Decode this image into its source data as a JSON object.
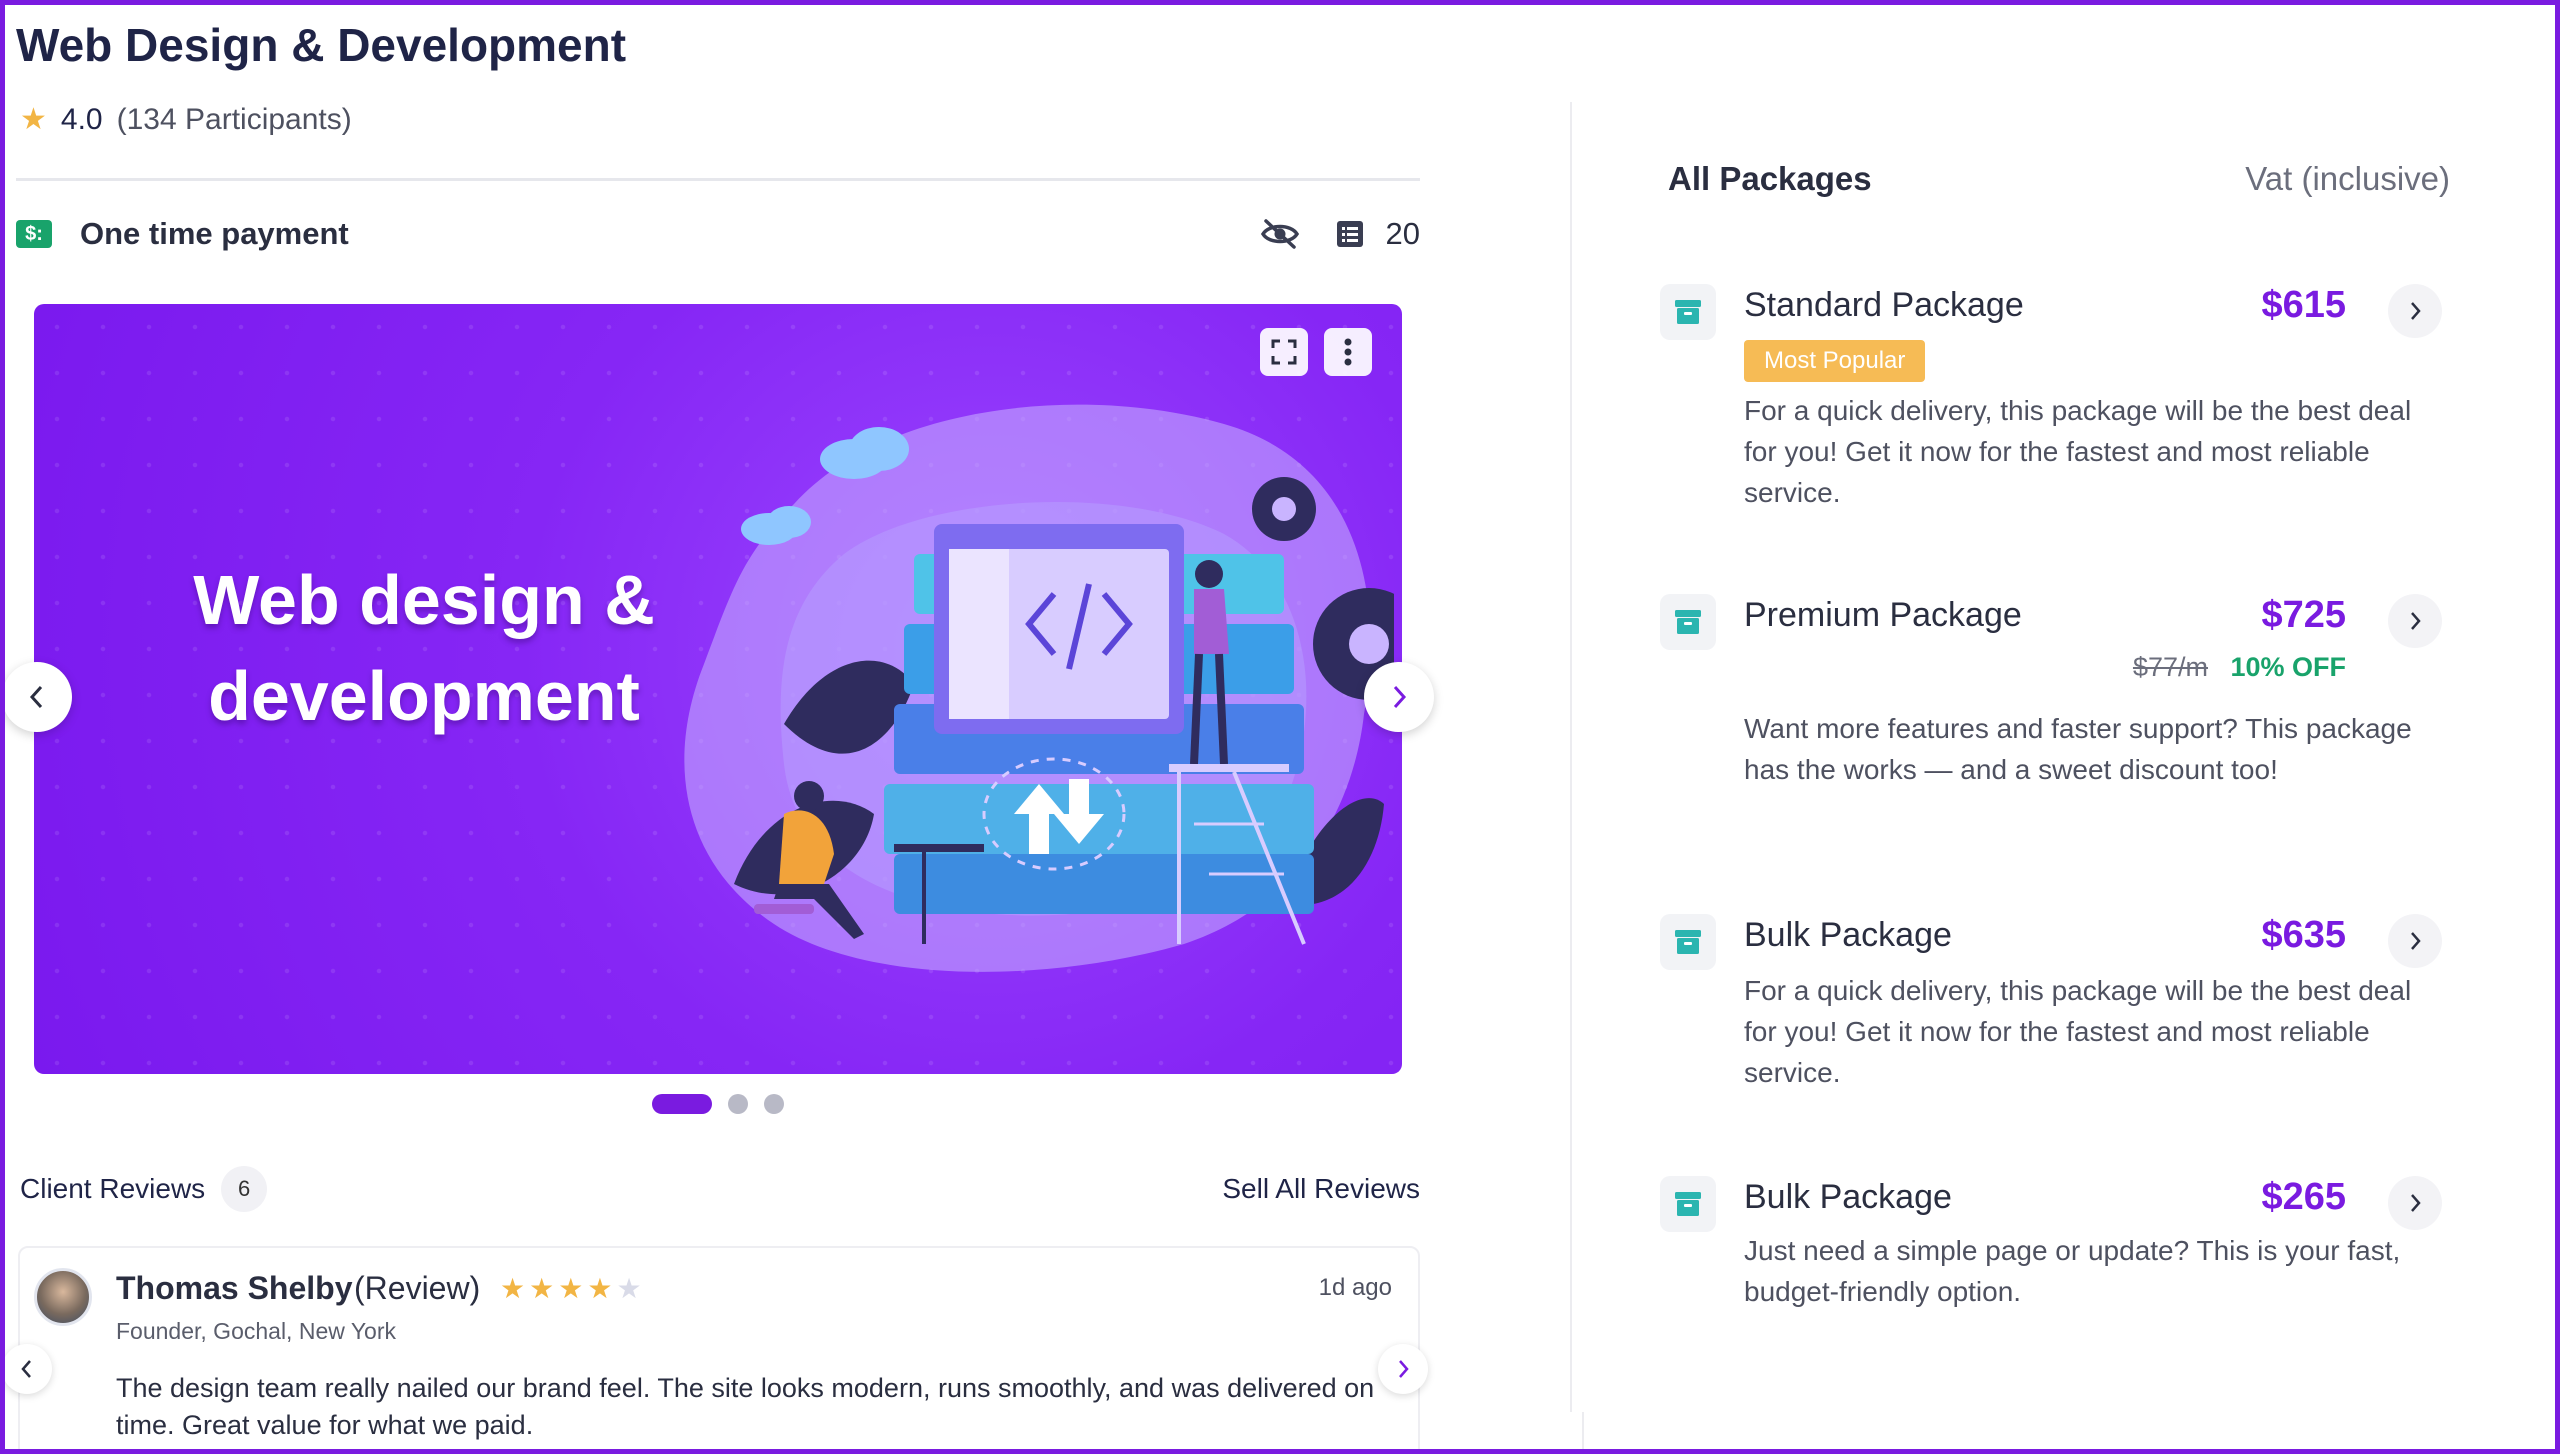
{
  "course": {
    "title": "Web Design & Development",
    "rating": "4.0",
    "participants": "(134 Participants)"
  },
  "payment": {
    "label": "One time payment",
    "pay_icon_text": "$:",
    "lessons_count": "20"
  },
  "hero": {
    "text_line1": "Web design &",
    "text_line2": "development"
  },
  "reviews": {
    "title": "Client Reviews",
    "count": "6",
    "see_all_label": "Sell All Reviews",
    "items": [
      {
        "name": "Thomas Shelby",
        "tag": "(Review)",
        "stars_filled": 4,
        "stars_total": 5,
        "time": "1d ago",
        "role": "Founder, Gochal, New York",
        "text": "The design team really nailed our brand feel. The site looks modern, runs smoothly, and was delivered on time. Great value for what we paid."
      }
    ]
  },
  "packages": {
    "title": "All Packages",
    "vat_label": "Vat (inclusive)",
    "items": [
      {
        "name": "Standard Package",
        "price": "$615",
        "badge": "Most Popular",
        "description": "For a quick delivery, this package will be the best deal for you! Get it now for the fastest and most reliable service."
      },
      {
        "name": "Premium Package",
        "price": "$725",
        "old_price": "$77/m",
        "discount": "10% OFF",
        "description": "Want more features and faster support? This package has the works — and a sweet discount too!"
      },
      {
        "name": "Bulk Package",
        "price": "$635",
        "description": "For a quick delivery, this package will be the best deal for you! Get it now for the fastest and most reliable service."
      },
      {
        "name": "Bulk Package",
        "price": "$265",
        "description": "Just need a simple page or update? This is your fast, budget-friendly option."
      }
    ]
  },
  "colors": {
    "accent": "#7a1be0",
    "star": "#f2b544",
    "success": "#19a36b",
    "badge": "#f6bb55",
    "package_icon": "#2bb5b0"
  }
}
